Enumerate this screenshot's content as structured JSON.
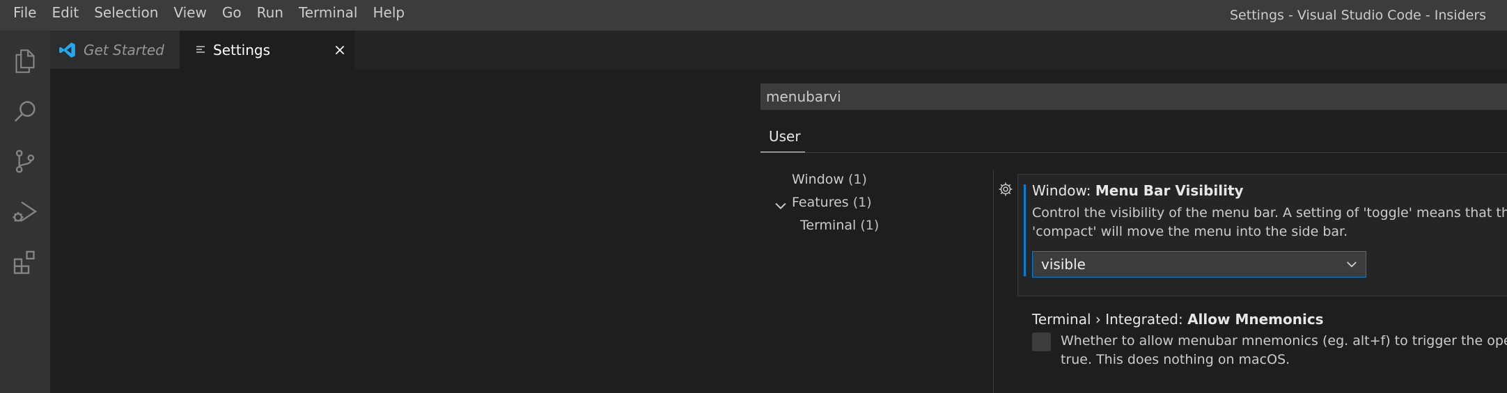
{
  "menubar": {
    "items": [
      "File",
      "Edit",
      "Selection",
      "View",
      "Go",
      "Run",
      "Terminal",
      "Help"
    ],
    "window_title": "Settings - Visual Studio Code - Insiders"
  },
  "activitybar": {
    "icons": [
      "files-icon",
      "search-icon",
      "source-control-icon",
      "run-debug-icon",
      "extensions-icon"
    ]
  },
  "tabs": [
    {
      "label": "Get Started",
      "icon": "vscode-logo-icon"
    },
    {
      "label": "Settings",
      "icon": "settings-file-icon",
      "active": true
    }
  ],
  "settings": {
    "search_value": "menubarvi",
    "scope_tab": "User",
    "toc": [
      {
        "label": "Window",
        "count": "(1)"
      },
      {
        "label": "Features",
        "count": "(1)",
        "expanded": true
      },
      {
        "label": "Terminal",
        "count": "(1)"
      }
    ],
    "items": [
      {
        "category": "Window: ",
        "name": "Menu Bar Visibility",
        "description_line1": "Control the visibility of the menu bar. A setting of 'toggle' means that the menu",
        "description_line2": "'compact' will move the menu into the side bar.",
        "value": "visible"
      },
      {
        "category": "Terminal › Integrated: ",
        "name": "Allow Mnemonics",
        "description_line1": "Whether to allow menubar mnemonics (eg. alt+f) to trigger the open the m",
        "description_line2": "true. This does nothing on macOS.",
        "checked": false
      }
    ]
  },
  "colors": {
    "accent": "#007fd4",
    "vscode_logo": "#23a9f2",
    "editor_bg": "#1e1e1e",
    "titlebar_bg": "#3c3c3c",
    "activitybar_bg": "#333333"
  }
}
